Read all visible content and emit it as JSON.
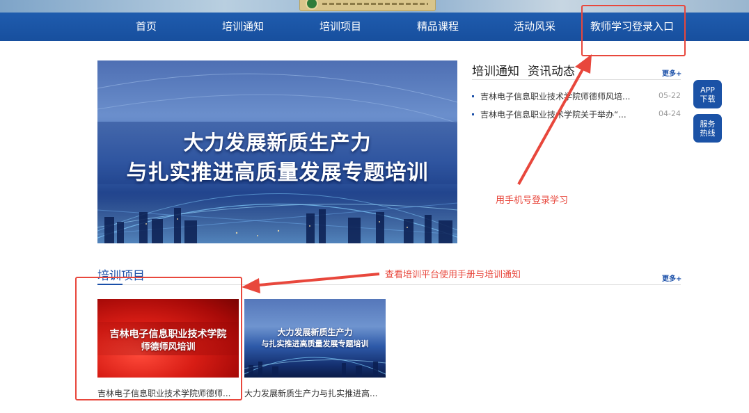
{
  "nav": {
    "items": [
      "首页",
      "培训通知",
      "培训项目",
      "精品课程",
      "活动风采",
      "教师学习登录入口"
    ]
  },
  "hero": {
    "line1": "大力发展新质生产力",
    "line2": "与扎实推进高质量发展专题培训"
  },
  "news": {
    "tabs": [
      "培训通知",
      "资讯动态"
    ],
    "more": "更多+",
    "items": [
      {
        "title": "吉林电子信息职业技术学院师德师风培...",
        "date": "05-22"
      },
      {
        "title": "吉林电子信息职业技术学院关于举办“...",
        "date": "04-24"
      }
    ]
  },
  "side": {
    "app": "APP 下载",
    "service": "服务 热线"
  },
  "projects": {
    "title": "培训项目",
    "more": "更多+",
    "cards": [
      {
        "thumb_line1": "吉林电子信息职业技术学院",
        "thumb_line2": "师德师风培训",
        "caption": "吉林电子信息职业技术学院师德师..."
      },
      {
        "thumb_line1": "大力发展新质生产力",
        "thumb_line2": "与扎实推进高质量发展专题培训",
        "caption": "大力发展新质生产力与扎实推进高..."
      }
    ]
  },
  "annotations": {
    "login_hint": "用手机号登录学习",
    "manual_hint": "查看培训平台使用手册与培训通知"
  },
  "colors": {
    "nav_blue": "#1b53a5",
    "accent": "#1a4fa8",
    "annotation_red": "#e8473c"
  }
}
